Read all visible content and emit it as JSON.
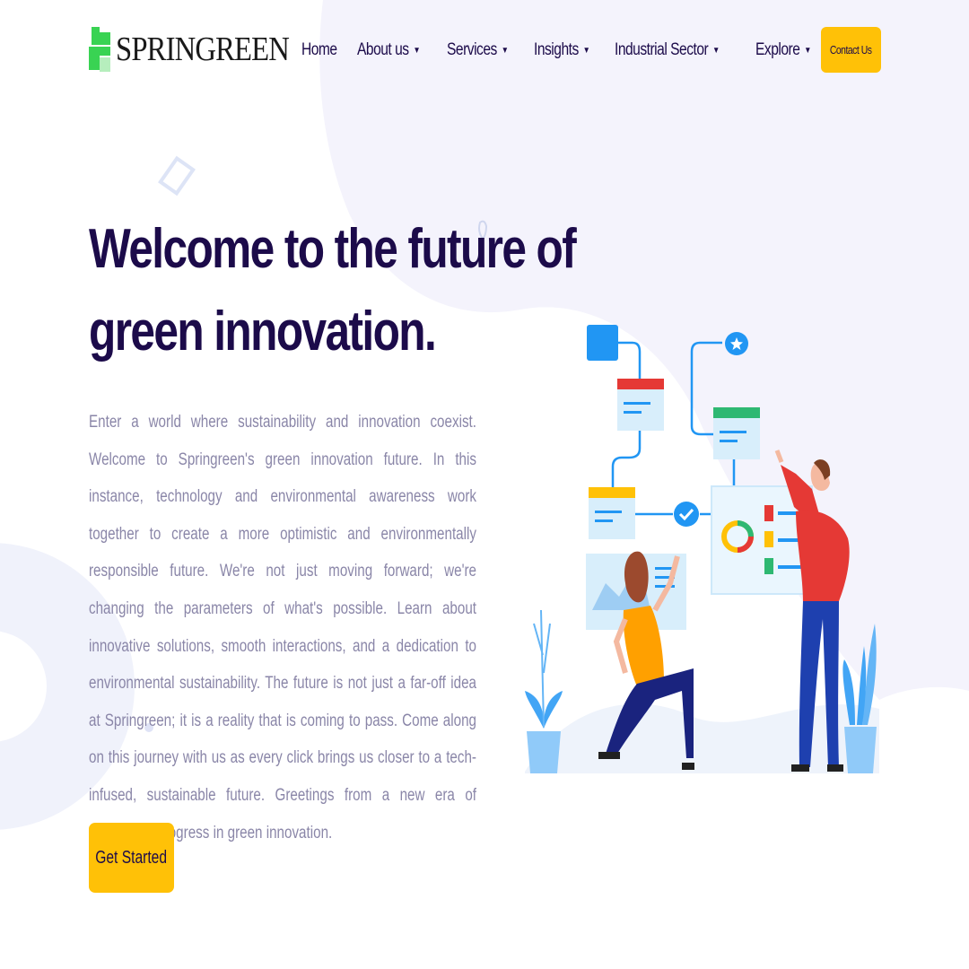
{
  "brand": {
    "name": "SPRINGREEN",
    "accent_green": "#39d353",
    "accent_yellow": "#ffc107",
    "text_dark": "#1c0b4a"
  },
  "nav": {
    "items": [
      {
        "label": "Home",
        "has_dropdown": false
      },
      {
        "label": "About us",
        "has_dropdown": true
      },
      {
        "label": "Services",
        "has_dropdown": true
      },
      {
        "label": "Insights",
        "has_dropdown": true
      },
      {
        "label": "Industrial Sector",
        "has_dropdown": true
      },
      {
        "label": "Explore",
        "has_dropdown": true
      }
    ],
    "contact_label": "Contact Us"
  },
  "hero": {
    "title_line1": "Welcome to the future of",
    "title_line2": "green innovation.",
    "description": "Enter a world where sustainability and innovation coexist. Welcome to Springreen's green innovation future. In this instance, technology and environmental awareness work together to create a more optimistic and environmentally responsible future. We're not just moving forward; we're changing the parameters of what's possible. Learn about innovative solutions, smooth interactions, and a dedication to environmental sustainability. The future is not just a far-off idea at Springreen; it is a reality that is coming to pass. Come along on this journey with us as every click brings us closer to a tech-infused, sustainable future. Greetings from a new era of purposeful progress in green innovation.",
    "cta_label": "Get Started"
  },
  "icons": {
    "caret": "caret-down-icon",
    "star": "star-icon",
    "check": "check-icon"
  }
}
